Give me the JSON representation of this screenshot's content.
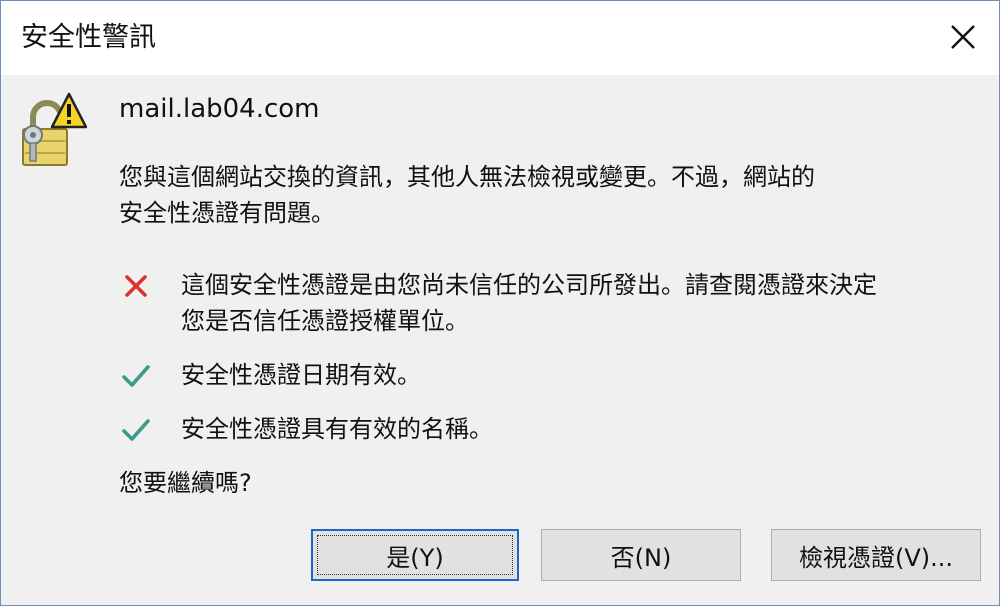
{
  "window": {
    "title": "安全性警訊"
  },
  "content": {
    "host": "mail.lab04.com",
    "description_line1": "您與這個網站交換的資訊，其他人無法檢視或變更。不過，網站的",
    "description_line2": "安全性憑證有問題。",
    "checks": [
      {
        "status": "error",
        "icon": "red-x-icon",
        "color": "#d9342b",
        "line1": "這個安全性憑證是由您尚未信任的公司所發出。請查閱憑證來決定",
        "line2": "您是否信任憑證授權單位。"
      },
      {
        "status": "ok",
        "icon": "green-check-icon",
        "color": "#3c9b8a",
        "line1": "安全性憑證日期有效。"
      },
      {
        "status": "ok",
        "icon": "green-check-icon",
        "color": "#3c9b8a",
        "line1": "安全性憑證具有有效的名稱。"
      }
    ],
    "question": "您要繼續嗎?"
  },
  "buttons": {
    "yes_label": "是(Y)",
    "no_label": "否(N)",
    "view_label": "檢視憑證(V)..."
  },
  "colors": {
    "dialog_bg": "#f0f0f0",
    "titlebar_bg": "#ffffff",
    "default_button_border": "#1f66c6",
    "warning_yellow": "#f5d327"
  }
}
